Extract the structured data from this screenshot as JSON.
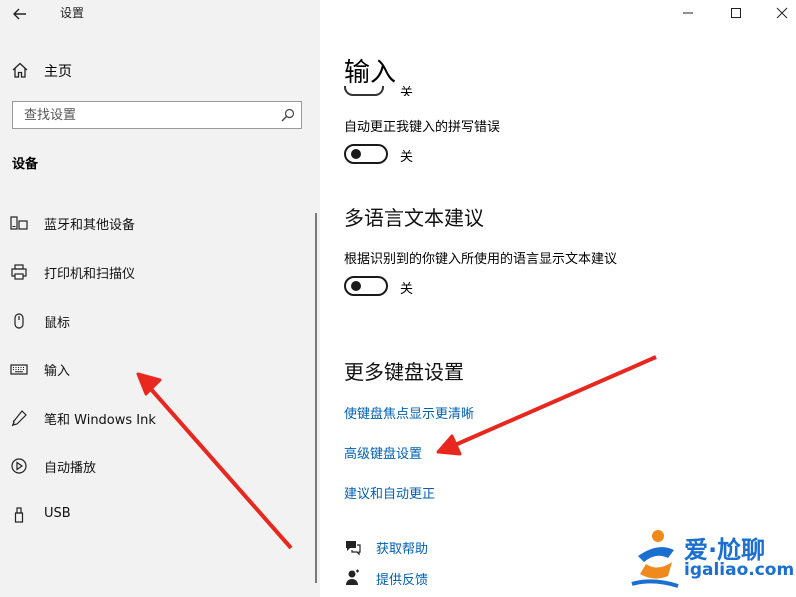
{
  "window": {
    "title": "设置",
    "controls": [
      "minimize",
      "maximize",
      "close"
    ]
  },
  "sidebar": {
    "home_label": "主页",
    "search_placeholder": "查找设置",
    "section_heading": "设备",
    "items": [
      {
        "label": "蓝牙和其他设备",
        "icon": "bluetooth-devices-icon"
      },
      {
        "label": "打印机和扫描仪",
        "icon": "printer-icon"
      },
      {
        "label": "鼠标",
        "icon": "mouse-icon"
      },
      {
        "label": "输入",
        "icon": "keyboard-icon"
      },
      {
        "label": "笔和 Windows Ink",
        "icon": "pen-icon"
      },
      {
        "label": "自动播放",
        "icon": "autoplay-icon"
      },
      {
        "label": "USB",
        "icon": "usb-icon"
      }
    ]
  },
  "main": {
    "page_title": "输入",
    "partial_toggle_state": "关",
    "autocorrect": {
      "label": "自动更正我键入的拼写错误",
      "state": "关",
      "on": false
    },
    "multilingual": {
      "title": "多语言文本建议",
      "label": "根据识别到的你键入所使用的语言显示文本建议",
      "state": "关",
      "on": false
    },
    "more_keyboard": {
      "title": "更多键盘设置",
      "links": [
        "使键盘焦点显示更清晰",
        "高级键盘设置",
        "建议和自动更正"
      ]
    },
    "help": {
      "get_help": "获取帮助",
      "feedback": "提供反馈"
    }
  },
  "watermark": {
    "brand": "爱·尬聊",
    "url": "igaliao.com"
  },
  "colors": {
    "sidebar_bg": "#f2f2f2",
    "link": "#0060b4",
    "arrow": "#e8281e",
    "watermark_blue": "#1a6fd0",
    "watermark_orange": "#f08a1c"
  }
}
